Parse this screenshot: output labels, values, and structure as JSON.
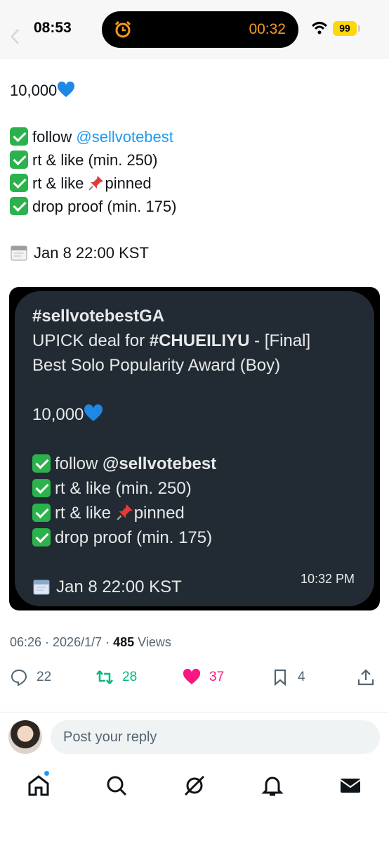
{
  "status_bar": {
    "time": "08:53",
    "timer": "00:32",
    "battery": "99",
    "icons": [
      "alarm-clock-icon",
      "wifi-icon",
      "battery-icon"
    ]
  },
  "tweet": {
    "lines": {
      "count": "10,000",
      "follow_prefix": "follow",
      "follow_mention": "@sellvotebest",
      "rt_like": "rt & like (min. 250)",
      "rt_like_pinned_prefix": "rt & like",
      "rt_like_pinned_suffix": "pinned",
      "drop_proof": "drop proof (min. 175)",
      "date": "Jan 8 22:00 KST"
    }
  },
  "media": {
    "hashtag": "#sellvotebestGA",
    "line2_prefix": "UPICK deal for",
    "line2_hashtag": "#CHUEILIYU",
    "line2_suffix": "- [Final]",
    "line3": "Best Solo Popularity Award (Boy)",
    "count": "10,000",
    "follow_prefix": "follow",
    "follow_mention": "@sellvotebest",
    "rt_like": "rt & like (min. 250)",
    "rt_like_pinned_prefix": "rt & like",
    "rt_like_pinned_suffix": "pinned",
    "drop_proof": "drop proof (min. 175)",
    "date": "Jan 8 22:00 KST",
    "time": "10:32 PM"
  },
  "meta": {
    "timestamp": "06:26 · 2026/1/7 · ",
    "views_count": "485",
    "views_label": " Views"
  },
  "actions": {
    "replies": "22",
    "reposts": "28",
    "likes": "37",
    "bookmarks": "4"
  },
  "reply_bar": {
    "placeholder": "Post your reply"
  },
  "colors": {
    "accent": "#1d9bf0",
    "repost": "#00ba7c",
    "like": "#f91880",
    "card_bg": "#222a33"
  }
}
